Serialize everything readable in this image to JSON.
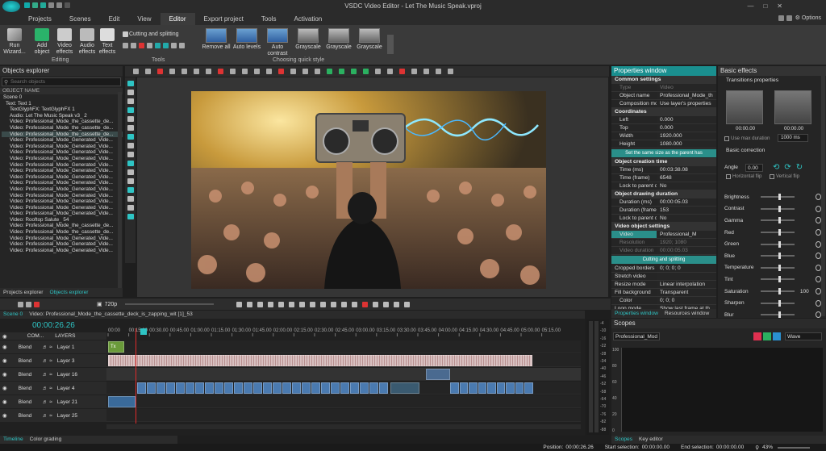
{
  "app": {
    "title": "VSDC Video Editor - Let The Music Speak.vproj",
    "options_label": "Options"
  },
  "menu": {
    "items": [
      "Projects",
      "Scenes",
      "Edit",
      "View",
      "Editor",
      "Export project",
      "Tools",
      "Activation"
    ],
    "active": "Editor"
  },
  "ribbon": {
    "run_wizard": "Run Wizard...",
    "add_object": "Add object",
    "video_effects": "Video effects",
    "audio_effects": "Audio effects",
    "text_effects": "Text effects",
    "editing_group": "Editing",
    "cutting_splitting": "Cutting and splitting",
    "tools_group": "Tools",
    "quick_styles": [
      "Remove all",
      "Auto levels",
      "Auto contrast",
      "Grayscale",
      "Grayscale",
      "Grayscale"
    ],
    "quick_style_group": "Choosing quick style"
  },
  "objects_explorer": {
    "title": "Objects explorer",
    "search_placeholder": "Search objects",
    "column": "OBJECT NAME",
    "items": [
      "Scene 0",
      "Text: Text 1",
      "TextGlyphFX: TextGlyphFX 1",
      "Audio: Let The Music Speak v3_ 2",
      "Video: Professional_Mode_the_cassette_de...",
      "Video: Professional_Mode_the_cassette_de...",
      "Video: Professional_Mode_the_cassette_de...",
      "Video: Professional_Mode_Generated_Vide...",
      "Video: Professional_Mode_Generated_Vide...",
      "Video: Professional_Mode_Generated_Vide...",
      "Video: Professional_Mode_Generated_Vide...",
      "Video: Professional_Mode_Generated_Vide...",
      "Video: Professional_Mode_Generated_Vide...",
      "Video: Professional_Mode_Generated_Vide...",
      "Video: Professional_Mode_Generated_Vide...",
      "Video: Professional_Mode_Generated_Vide...",
      "Video: Professional_Mode_Generated_Vide...",
      "Video: Professional_Mode_Generated_Vide...",
      "Video: Professional_Mode_Generated_Vide...",
      "Video: Professional_Mode_Generated_Vide...",
      "Video: Rooftop Salute_ 54",
      "Video: Professional_Mode_the_cassette_de...",
      "Video: Professional_Mode_the_cassette_de...",
      "Video: Professional_Mode_Generated_Vide...",
      "Video: Professional_Mode_Generated_Vide...",
      "Video: Professional_Mode_Generated_Vide..."
    ],
    "tabs": [
      "Projects explorer",
      "Objects explorer"
    ]
  },
  "preview": {
    "zoom": "720p"
  },
  "properties": {
    "title": "Properties window",
    "common_settings": "Common settings",
    "type_k": "Type",
    "type_v": "Video",
    "object_name_k": "Object name",
    "object_name_v": "Professional_Mode_th",
    "composition_k": "Composition mod",
    "composition_v": "Use layer's properties",
    "coordinates": "Coordinates",
    "left_k": "Left",
    "left_v": "0.000",
    "top_k": "Top",
    "top_v": "0.000",
    "width_k": "Width",
    "width_v": "1920.000",
    "height_k": "Height",
    "height_v": "1080.000",
    "same_size_btn": "Set the same size as the parent has",
    "creation_time": "Object creation time",
    "time_ms_k": "Time (ms)",
    "time_ms_v": "00:03:38.08",
    "time_frame_k": "Time (frame)",
    "time_frame_v": "6548",
    "lock_parent_k": "Lock to parent c",
    "lock_parent_v": "No",
    "drawing_duration": "Object drawing duration",
    "dur_ms_k": "Duration (ms)",
    "dur_ms_v": "00:00:05.03",
    "dur_frame_k": "Duration (frame",
    "dur_frame_v": "153",
    "lock_parent2_k": "Lock to parent c",
    "lock_parent2_v": "No",
    "video_settings": "Video object settings",
    "video_k": "Video",
    "video_v": "Professional_M",
    "resolution_k": "Resolution",
    "resolution_v": "1920; 1080",
    "video_dur_k": "Video duration",
    "video_dur_v": "00:00:05.03",
    "cutting_btn": "Cutting and splitting",
    "cropped_k": "Cropped borders",
    "cropped_v": "0; 0; 0; 0",
    "stretch_k": "Stretch video",
    "stretch_v": "",
    "resize_k": "Resize mode",
    "resize_v": "Linear interpolation",
    "fill_k": "Fill background",
    "fill_v": "Transparent",
    "color_k": "Color",
    "color_v": "0; 0; 0",
    "loop_k": "Loop mode",
    "loop_v": "Show last frame at th",
    "tabs": [
      "Properties window",
      "Resources window"
    ]
  },
  "basic_effects": {
    "title": "Basic effects",
    "transitions": "Transitions properties",
    "trans_time1": "00:00.00",
    "trans_time2": "00:00.00",
    "use_max": "Use max duration",
    "max_value": "1000 ms",
    "basic_correction": "Basic correction",
    "angle_label": "Angle",
    "angle_value": "0.00",
    "hflip": "Horizontal flip",
    "vflip": "Vertical flip",
    "sliders": [
      {
        "label": "Brightness",
        "value": ""
      },
      {
        "label": "Contrast",
        "value": ""
      },
      {
        "label": "Gamma",
        "value": ""
      },
      {
        "label": "Red",
        "value": ""
      },
      {
        "label": "Green",
        "value": ""
      },
      {
        "label": "Blue",
        "value": ""
      },
      {
        "label": "Temperature",
        "value": ""
      },
      {
        "label": "Tint",
        "value": ""
      },
      {
        "label": "Saturation",
        "value": "100"
      },
      {
        "label": "Sharpen",
        "value": ""
      },
      {
        "label": "Blur",
        "value": ""
      }
    ]
  },
  "timeline": {
    "scene_tab": "Scene 0",
    "clip_tab": "Video: Professional_Mode_the_cassette_deck_is_zapping_wit [1]_53",
    "current_time": "00:00:26.26",
    "col_com": "COM...",
    "col_layers": "LAYERS",
    "ruler": [
      "00:00",
      "00:15.00",
      "00:30.00",
      "00:45.00",
      "01:00.00",
      "01:15.00",
      "01:30.00",
      "01:45.00",
      "02:00.00",
      "02:15.00",
      "02:30.00",
      "02:45.00",
      "03:00.00",
      "03:15.00",
      "03:30.00",
      "03:45.00",
      "04:00.00",
      "04:15.00",
      "04:30.00",
      "04:45.00",
      "05:00.00",
      "05:15.00"
    ],
    "tracks": [
      {
        "blend": "Blend",
        "name": "Layer 1"
      },
      {
        "blend": "Blend",
        "name": "Layer 3"
      },
      {
        "blend": "Blend",
        "name": "Layer 16"
      },
      {
        "blend": "Blend",
        "name": "Layer 4"
      },
      {
        "blend": "Blend",
        "name": "Layer 21"
      },
      {
        "blend": "Blend",
        "name": "Layer 25"
      }
    ],
    "text_clip": "Tx",
    "bottom_tabs": [
      "Timeline",
      "Color grading"
    ]
  },
  "scopes": {
    "title": "Scopes",
    "source": "Professional_Mod",
    "mode": "Wave",
    "scale": [
      "100",
      "80",
      "60",
      "40",
      "20",
      "0"
    ],
    "tabs": [
      "Scopes",
      "Key editor"
    ]
  },
  "meter_scale": [
    "-4",
    "-10",
    "-16",
    "-22",
    "-28",
    "-34",
    "-40",
    "-46",
    "-52",
    "-58",
    "-64",
    "-70",
    "-76",
    "-82",
    "-88"
  ],
  "statusbar": {
    "position_label": "Position:",
    "position": "00:00:26.26",
    "start_label": "Start selection:",
    "start": "00:00:00.00",
    "end_label": "End selection:",
    "end": "00:00:00.00",
    "zoom": "43%"
  }
}
